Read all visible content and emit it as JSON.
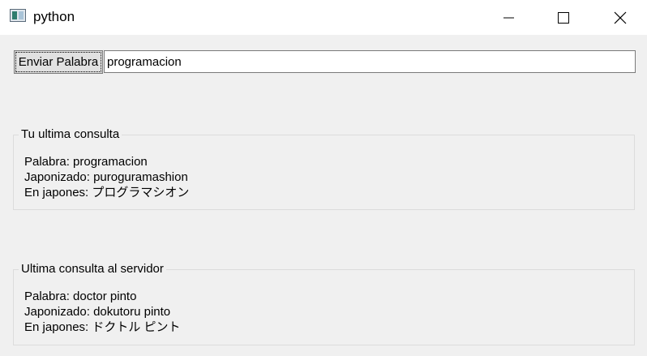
{
  "window": {
    "title": "python",
    "icon": "app-window-icon",
    "controls": [
      "minimize-icon",
      "maximize-icon",
      "close-icon"
    ]
  },
  "toolbar": {
    "send_label": "Enviar Palabra",
    "word_value": "programacion"
  },
  "last_query": {
    "legend": "Tu ultima consulta",
    "palabra": "Palabra: programacion",
    "japonizado": "Japonizado: puroguramashion",
    "japones": "En japones: プログラマシオン"
  },
  "server_query": {
    "legend": "Ultima consulta al servidor",
    "palabra": "Palabra: doctor pinto",
    "japonizado": "Japonizado: dokutoru pinto",
    "japones": "En japones: ドクトル ピント"
  }
}
